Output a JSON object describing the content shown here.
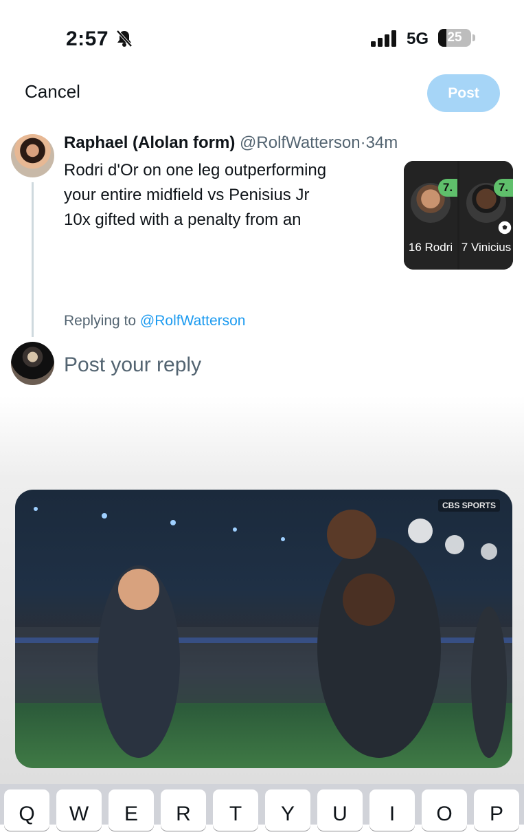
{
  "status_bar": {
    "time": "2:57",
    "network": "5G",
    "battery": "25"
  },
  "composer": {
    "cancel_label": "Cancel",
    "post_label": "Post",
    "post_button_color": "#a6d5f7"
  },
  "original_post": {
    "display_name": "Raphael (Alolan form)",
    "handle": "@RolfWatterson",
    "separator": "·",
    "time_ago": "34m",
    "text_lines": [
      "Rodri d'Or on one leg outperforming",
      "your entire midfield vs Penisius Jr",
      "10x gifted with a penalty from an"
    ],
    "media": {
      "cards": [
        {
          "rating": "7.",
          "label": "16 Rodri"
        },
        {
          "rating": "7.",
          "label": "7 Vinicius"
        }
      ]
    }
  },
  "reply": {
    "replying_prefix": "Replying to",
    "replying_handle": "@RolfWatterson",
    "placeholder": "Post your reply"
  },
  "video": {
    "watermark": "CBS SPORTS"
  },
  "keyboard": {
    "keys": [
      "Q",
      "W",
      "E",
      "R",
      "T",
      "Y",
      "U",
      "I",
      "O",
      "P"
    ]
  },
  "colors": {
    "link": "#1d9bf0",
    "secondary_text": "#536471",
    "rating_badge": "#5fbf6b"
  }
}
